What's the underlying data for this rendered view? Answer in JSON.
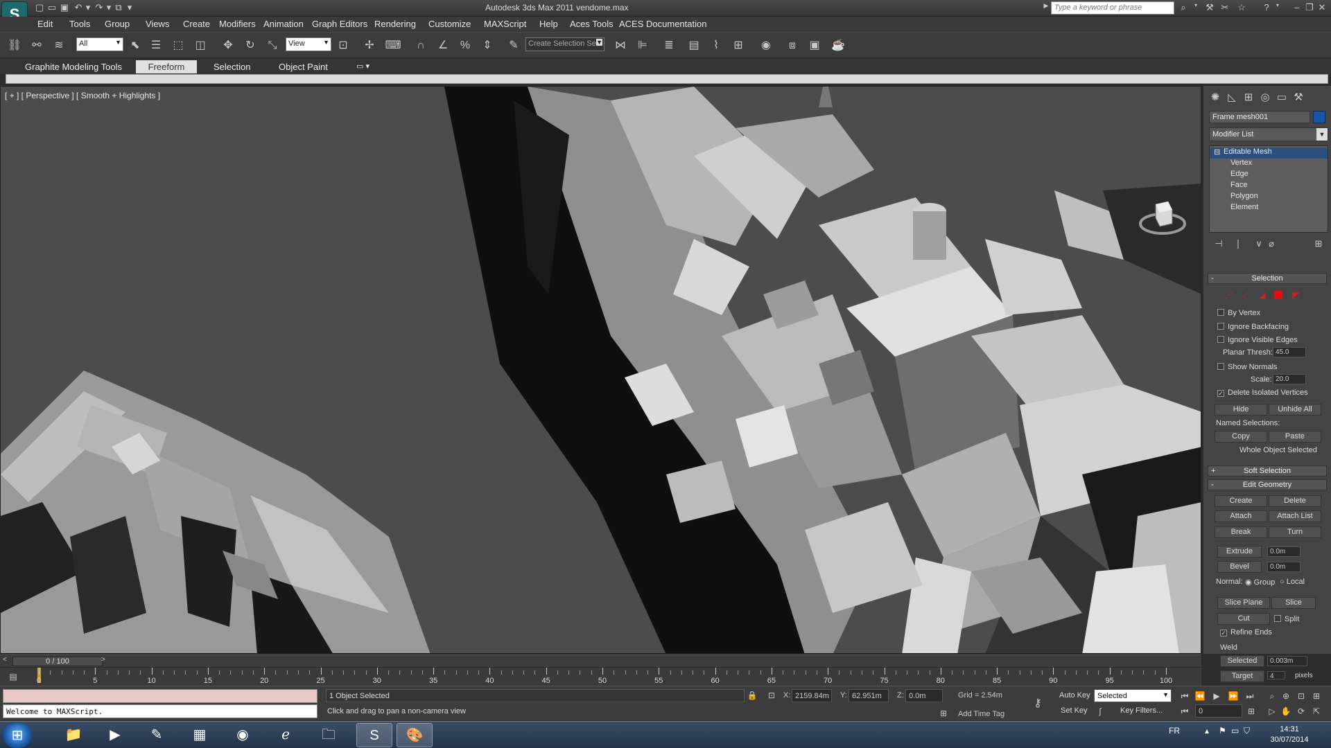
{
  "window": {
    "title": "Autodesk 3ds Max  2011       vendome.max",
    "search_placeholder": "Type a keyword or phrase"
  },
  "menu": [
    "Edit",
    "Tools",
    "Group",
    "Views",
    "Create",
    "Modifiers",
    "Animation",
    "Graph Editors",
    "Rendering",
    "Customize",
    "MAXScript",
    "Help",
    "Aces Tools",
    "ACES Documentation"
  ],
  "toolbar": {
    "filter_value": "All",
    "refcoord_value": "View",
    "named_selection_placeholder": "Create Selection Se"
  },
  "ribbon": {
    "tabs": [
      "Graphite Modeling Tools",
      "Freeform",
      "Selection",
      "Object Paint"
    ],
    "active_tab": "Freeform"
  },
  "viewport": {
    "label": "[ + ] [ Perspective ] [ Smooth + Highlights ]"
  },
  "command_panel": {
    "object_name": "Frame mesh001",
    "object_color": "#1856a8",
    "modifier_list": "Modifier List",
    "stack": {
      "top": "Editable Mesh",
      "subs": [
        "Vertex",
        "Edge",
        "Face",
        "Polygon",
        "Element"
      ]
    },
    "selection": {
      "title": "Selection",
      "by_vertex": "By Vertex",
      "ignore_backfacing": "Ignore Backfacing",
      "ignore_visible_edges": "Ignore Visible Edges",
      "planar_thresh_label": "Planar Thresh:",
      "planar_thresh_value": "45.0",
      "show_normals": "Show Normals",
      "scale_label": "Scale:",
      "scale_value": "20.0",
      "delete_isolated": "Delete Isolated Vertices",
      "hide": "Hide",
      "unhide_all": "Unhide All",
      "named_selections": "Named Selections:",
      "copy": "Copy",
      "paste": "Paste",
      "whole_object": "Whole Object Selected"
    },
    "soft_selection": "Soft Selection",
    "edit_geometry": {
      "title": "Edit Geometry",
      "create": "Create",
      "delete": "Delete",
      "attach": "Attach",
      "attach_list": "Attach List",
      "break": "Break",
      "turn": "Turn",
      "extrude": "Extrude",
      "extrude_value": "0.0m",
      "bevel": "Bevel",
      "bevel_value": "0.0m",
      "normal_label": "Normal:",
      "group": "Group",
      "local": "Local",
      "slice_plane": "Slice Plane",
      "slice": "Slice",
      "cut": "Cut",
      "split": "Split",
      "refine_ends": "Refine Ends",
      "weld": "Weld",
      "selected": "Selected",
      "selected_value": "0.003m",
      "target": "Target",
      "target_value": "4",
      "pixels": "pixels"
    }
  },
  "timeline": {
    "slider_label": "0 / 100",
    "ticks": [
      "0",
      "5",
      "10",
      "15",
      "20",
      "25",
      "30",
      "35",
      "40",
      "45",
      "50",
      "55",
      "60",
      "65",
      "70",
      "75",
      "80",
      "85",
      "90",
      "95",
      "100"
    ]
  },
  "status": {
    "maxscript_output": "Welcome to MAXScript.",
    "selection_info": "1 Object Selected",
    "prompt": "Click and drag to pan a non-camera view",
    "x_label": "X:",
    "x_value": "2159.84m",
    "y_label": "Y:",
    "y_value": "62.951m",
    "z_label": "Z:",
    "z_value": "0.0m",
    "grid": "Grid = 2.54m",
    "add_time_tag": "Add Time Tag",
    "auto_key": "Auto Key",
    "set_key": "Set Key",
    "key_mode": "Selected",
    "key_filters": "Key Filters...",
    "frame_value": "0"
  },
  "taskbar": {
    "lang": "FR",
    "time": "14:31",
    "date": "30/07/2014"
  }
}
